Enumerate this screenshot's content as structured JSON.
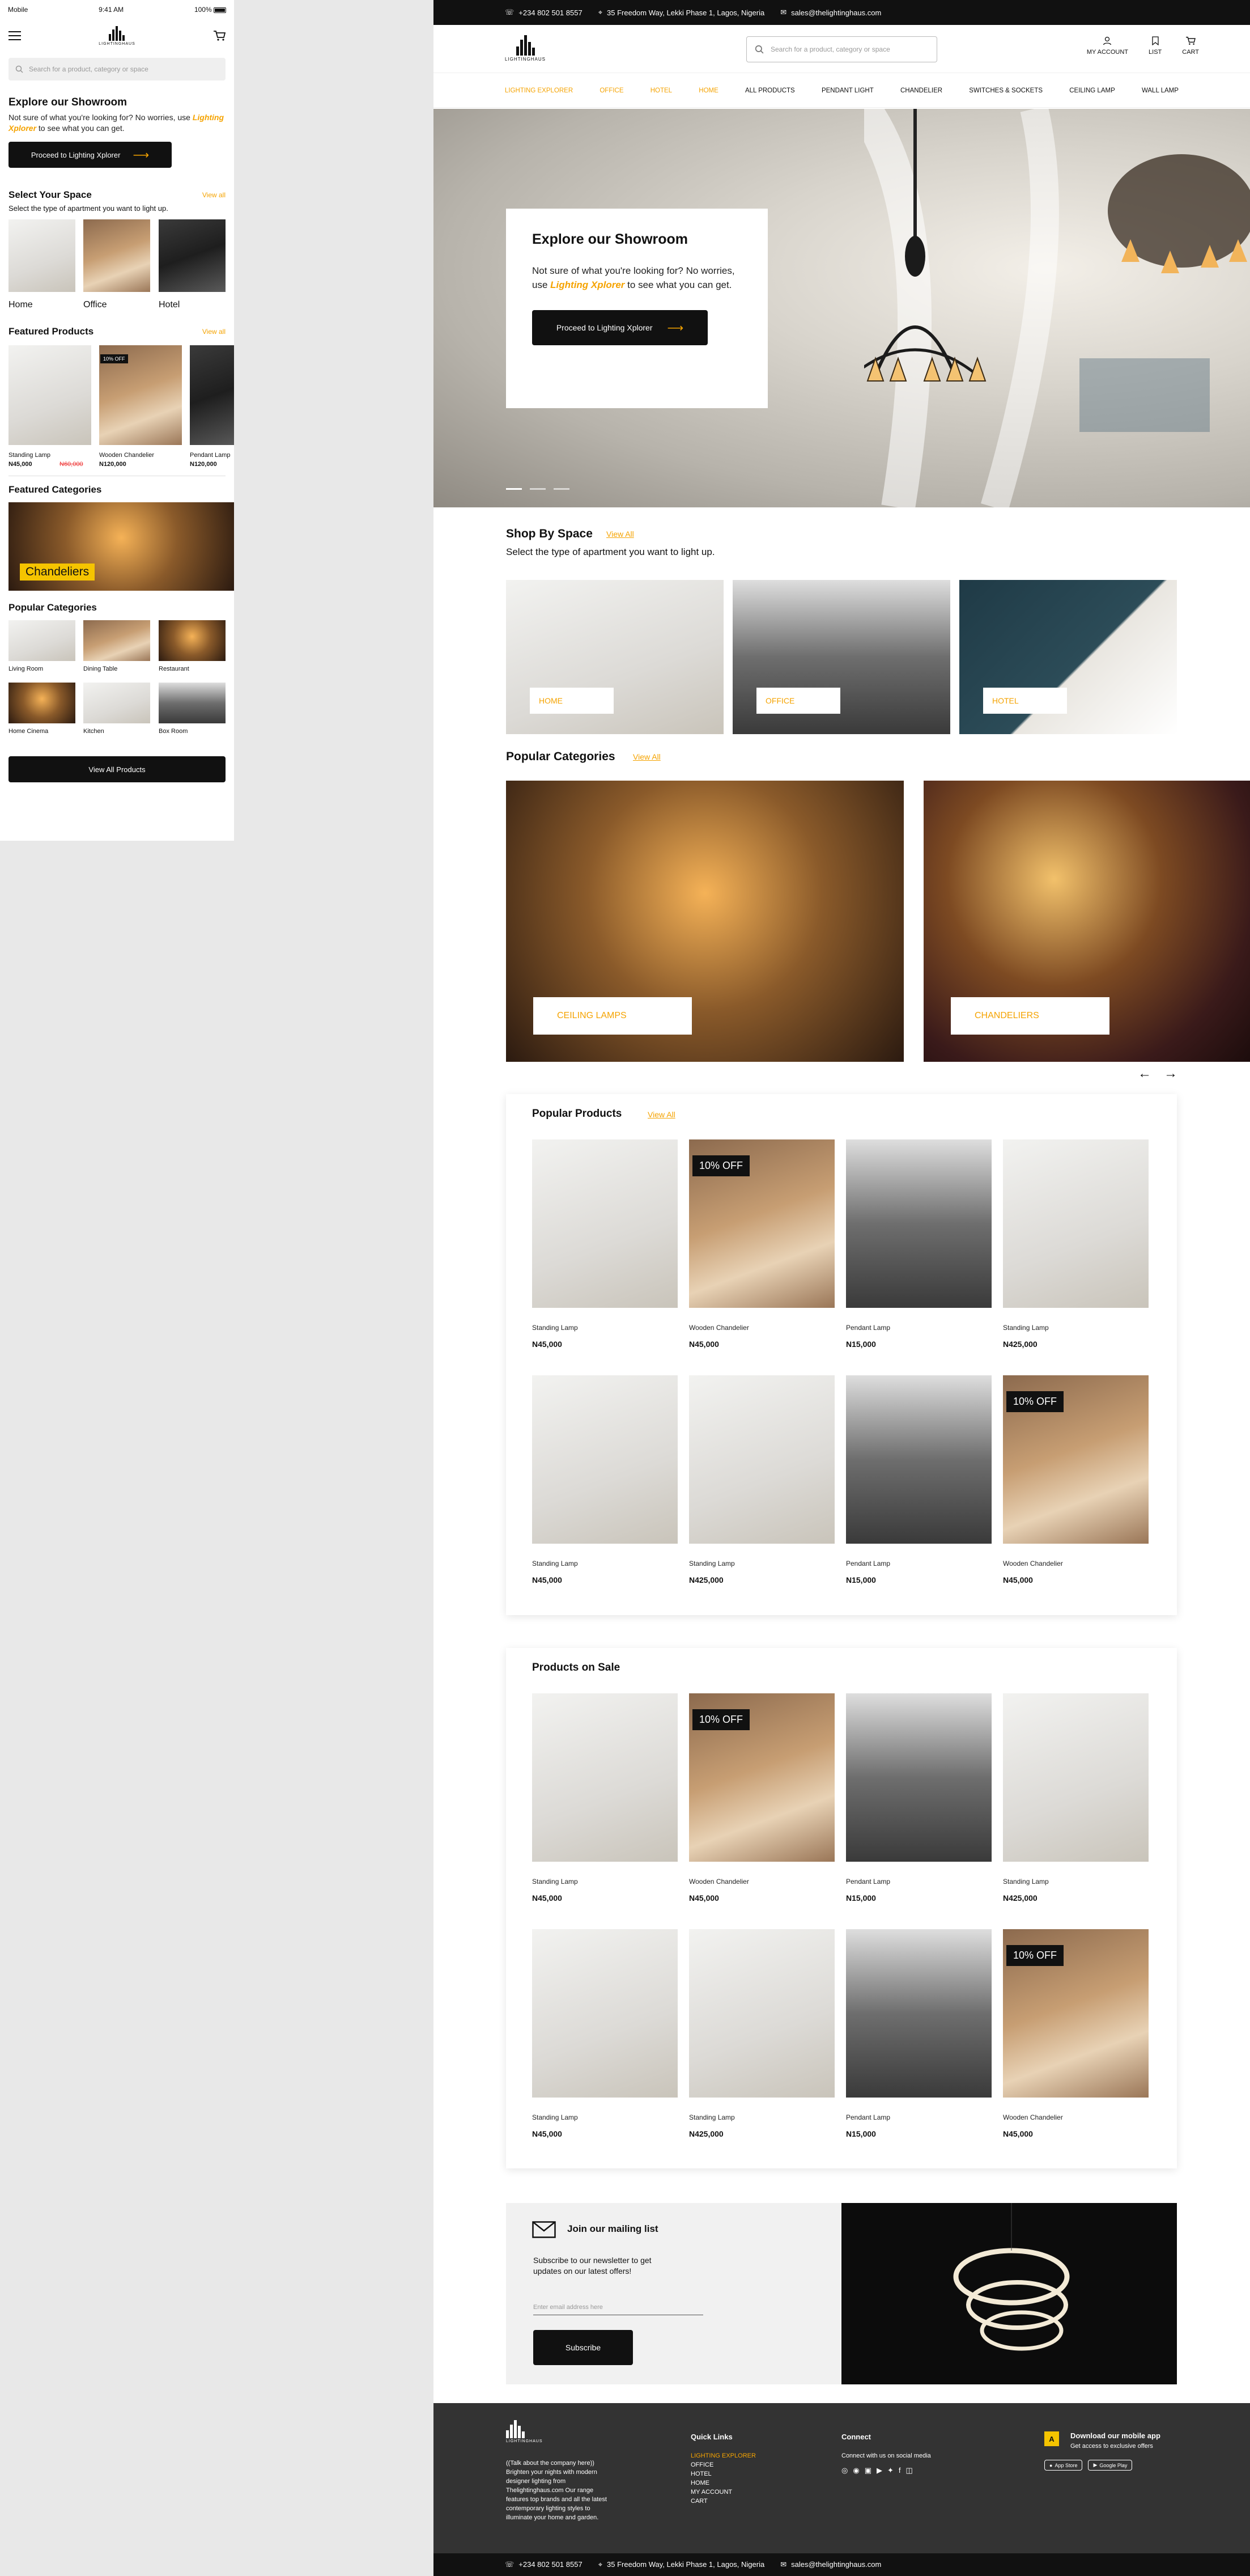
{
  "mobile": {
    "status": {
      "carrier": "Mobile",
      "time": "9:41 AM",
      "battery": "100%"
    },
    "logo_text": "LIGHTINGHAUS",
    "search_placeholder": "Search for a product, category or space",
    "showroom_title": "Explore our Showroom",
    "showroom_text_1": "Not sure of what you're looking for? No worries, use",
    "showroom_link": "Lighting Xplorer",
    "showroom_text_2": "to see what you can get.",
    "showroom_button": "Proceed to Lighting Xplorer",
    "select_space_title": "Select Your Space",
    "select_space_sub": "Select the type of apartment you want to light up.",
    "view_all": "View all",
    "spaces": [
      {
        "label": "Home"
      },
      {
        "label": "Office"
      },
      {
        "label": "Hotel"
      }
    ],
    "featured_products_title": "Featured Products",
    "featured_products": [
      {
        "name": "Standing Lamp",
        "price": "N45,000",
        "old_price": "N60,000",
        "badge": ""
      },
      {
        "name": "Wooden Chandelier",
        "price": "N120,000",
        "old_price": "",
        "badge": "10% OFF"
      },
      {
        "name": "Pendant Lamp",
        "price": "N120,000",
        "old_price": "",
        "badge": ""
      }
    ],
    "featured_categories_title": "Featured Categories",
    "featured_category_label": "Chandeliers",
    "popular_categories_title": "Popular Categories",
    "popular_categories": [
      "Living Room",
      "Dining Table",
      "Restaurant",
      "Home Cinema",
      "Kitchen",
      "Box Room"
    ],
    "view_all_products": "View All Products"
  },
  "desktop": {
    "topbar": {
      "phone": "+234 802 501 8557",
      "address": "35 Freedom Way, Lekki Phase 1, Lagos, Nigeria",
      "email": "sales@thelightinghaus.com"
    },
    "logo_text": "LIGHTINGHAUS",
    "search_placeholder": "Search for a product, category or space",
    "icons": {
      "account": "MY ACCOUNT",
      "list": "LIST",
      "cart": "CART"
    },
    "nav": [
      {
        "label": "LIGHTING EXPLORER",
        "active": true
      },
      {
        "label": "OFFICE",
        "active": true
      },
      {
        "label": "HOTEL",
        "active": true
      },
      {
        "label": "HOME",
        "active": true
      },
      {
        "label": "ALL PRODUCTS",
        "active": false
      },
      {
        "label": "PENDANT LIGHT",
        "active": false
      },
      {
        "label": "CHANDELIER",
        "active": false
      },
      {
        "label": "SWITCHES & SOCKETS",
        "active": false
      },
      {
        "label": "CEILING LAMP",
        "active": false
      },
      {
        "label": "WALL LAMP",
        "active": false
      }
    ],
    "hero": {
      "title": "Explore our Showroom",
      "text_1": "Not sure of what you're looking for? No worries, use",
      "link": "Lighting Xplorer",
      "text_2": "to see what you can get.",
      "button": "Proceed to Lighting Xplorer"
    },
    "shop_space": {
      "title": "Shop By Space",
      "view_all": "View All",
      "subtitle": "Select the type of apartment you want to light up.",
      "items": [
        "HOME",
        "OFFICE",
        "HOTEL"
      ]
    },
    "popular_categories": {
      "title": "Popular Categories",
      "view_all": "View All",
      "items": [
        "CEILING LAMPS",
        "CHANDELIERS"
      ]
    },
    "popular_products": {
      "title": "Popular Products",
      "view_all": "View All",
      "items": [
        {
          "name": "Standing Lamp",
          "price": "N45,000",
          "badge": "",
          "img": "white"
        },
        {
          "name": "Wooden Chandelier",
          "price": "N45,000",
          "badge": "10% OFF",
          "img": "dining"
        },
        {
          "name": "Pendant Lamp",
          "price": "N15,000",
          "badge": "",
          "img": "office"
        },
        {
          "name": "Standing Lamp",
          "price": "N425,000",
          "badge": "",
          "img": "white"
        },
        {
          "name": "Standing Lamp",
          "price": "N45,000",
          "badge": "",
          "img": "white"
        },
        {
          "name": "Standing Lamp",
          "price": "N425,000",
          "badge": "",
          "img": "white"
        },
        {
          "name": "Pendant Lamp",
          "price": "N15,000",
          "badge": "",
          "img": "office"
        },
        {
          "name": "Wooden Chandelier",
          "price": "N45,000",
          "badge": "10% OFF",
          "img": "dining"
        }
      ]
    },
    "products_on_sale": {
      "title": "Products on Sale",
      "items": [
        {
          "name": "Standing Lamp",
          "price": "N45,000",
          "badge": "",
          "img": "white"
        },
        {
          "name": "Wooden Chandelier",
          "price": "N45,000",
          "badge": "10% OFF",
          "img": "dining"
        },
        {
          "name": "Pendant Lamp",
          "price": "N15,000",
          "badge": "",
          "img": "office"
        },
        {
          "name": "Standing Lamp",
          "price": "N425,000",
          "badge": "",
          "img": "white"
        },
        {
          "name": "Standing Lamp",
          "price": "N45,000",
          "badge": "",
          "img": "white"
        },
        {
          "name": "Standing Lamp",
          "price": "N425,000",
          "badge": "",
          "img": "white"
        },
        {
          "name": "Pendant Lamp",
          "price": "N15,000",
          "badge": "",
          "img": "office"
        },
        {
          "name": "Wooden Chandelier",
          "price": "N45,000",
          "badge": "10% OFF",
          "img": "dining"
        }
      ]
    },
    "mailing": {
      "title": "Join our mailing list",
      "text": "Subscribe to our newsletter to get updates on our latest offers!",
      "placeholder": "Enter email address here",
      "button": "Subscribe"
    },
    "footer": {
      "about": "((Talk about the company here)) Brighten your nights with modern designer lighting from Thelightinghaus.com Our range features top brands and all the latest contemporary lighting styles to illuminate your home and garden.",
      "quick_links_title": "Quick Links",
      "quick_links": [
        {
          "label": "LIGHTING EXPLORER",
          "active": true
        },
        {
          "label": "OFFICE",
          "active": false
        },
        {
          "label": "HOTEL",
          "active": false
        },
        {
          "label": "HOME",
          "active": false
        },
        {
          "label": "MY ACCOUNT",
          "active": false
        },
        {
          "label": "CART",
          "active": false
        }
      ],
      "connect_title": "Connect",
      "connect_text": "Connect with us on social media",
      "app_title": "Download our mobile app",
      "app_text": "Get access to exclusive offers",
      "app_store": "App Store",
      "google_play": "Google Play"
    },
    "bottombar": {
      "phone": "+234 802 501 8557",
      "address": "35 Freedom Way, Lekki Phase 1, Lagos, Nigeria",
      "email": "sales@thelightinghaus.com"
    }
  },
  "colors": {
    "accent": "#f5a300",
    "dark": "#111111",
    "footer": "#333333"
  }
}
